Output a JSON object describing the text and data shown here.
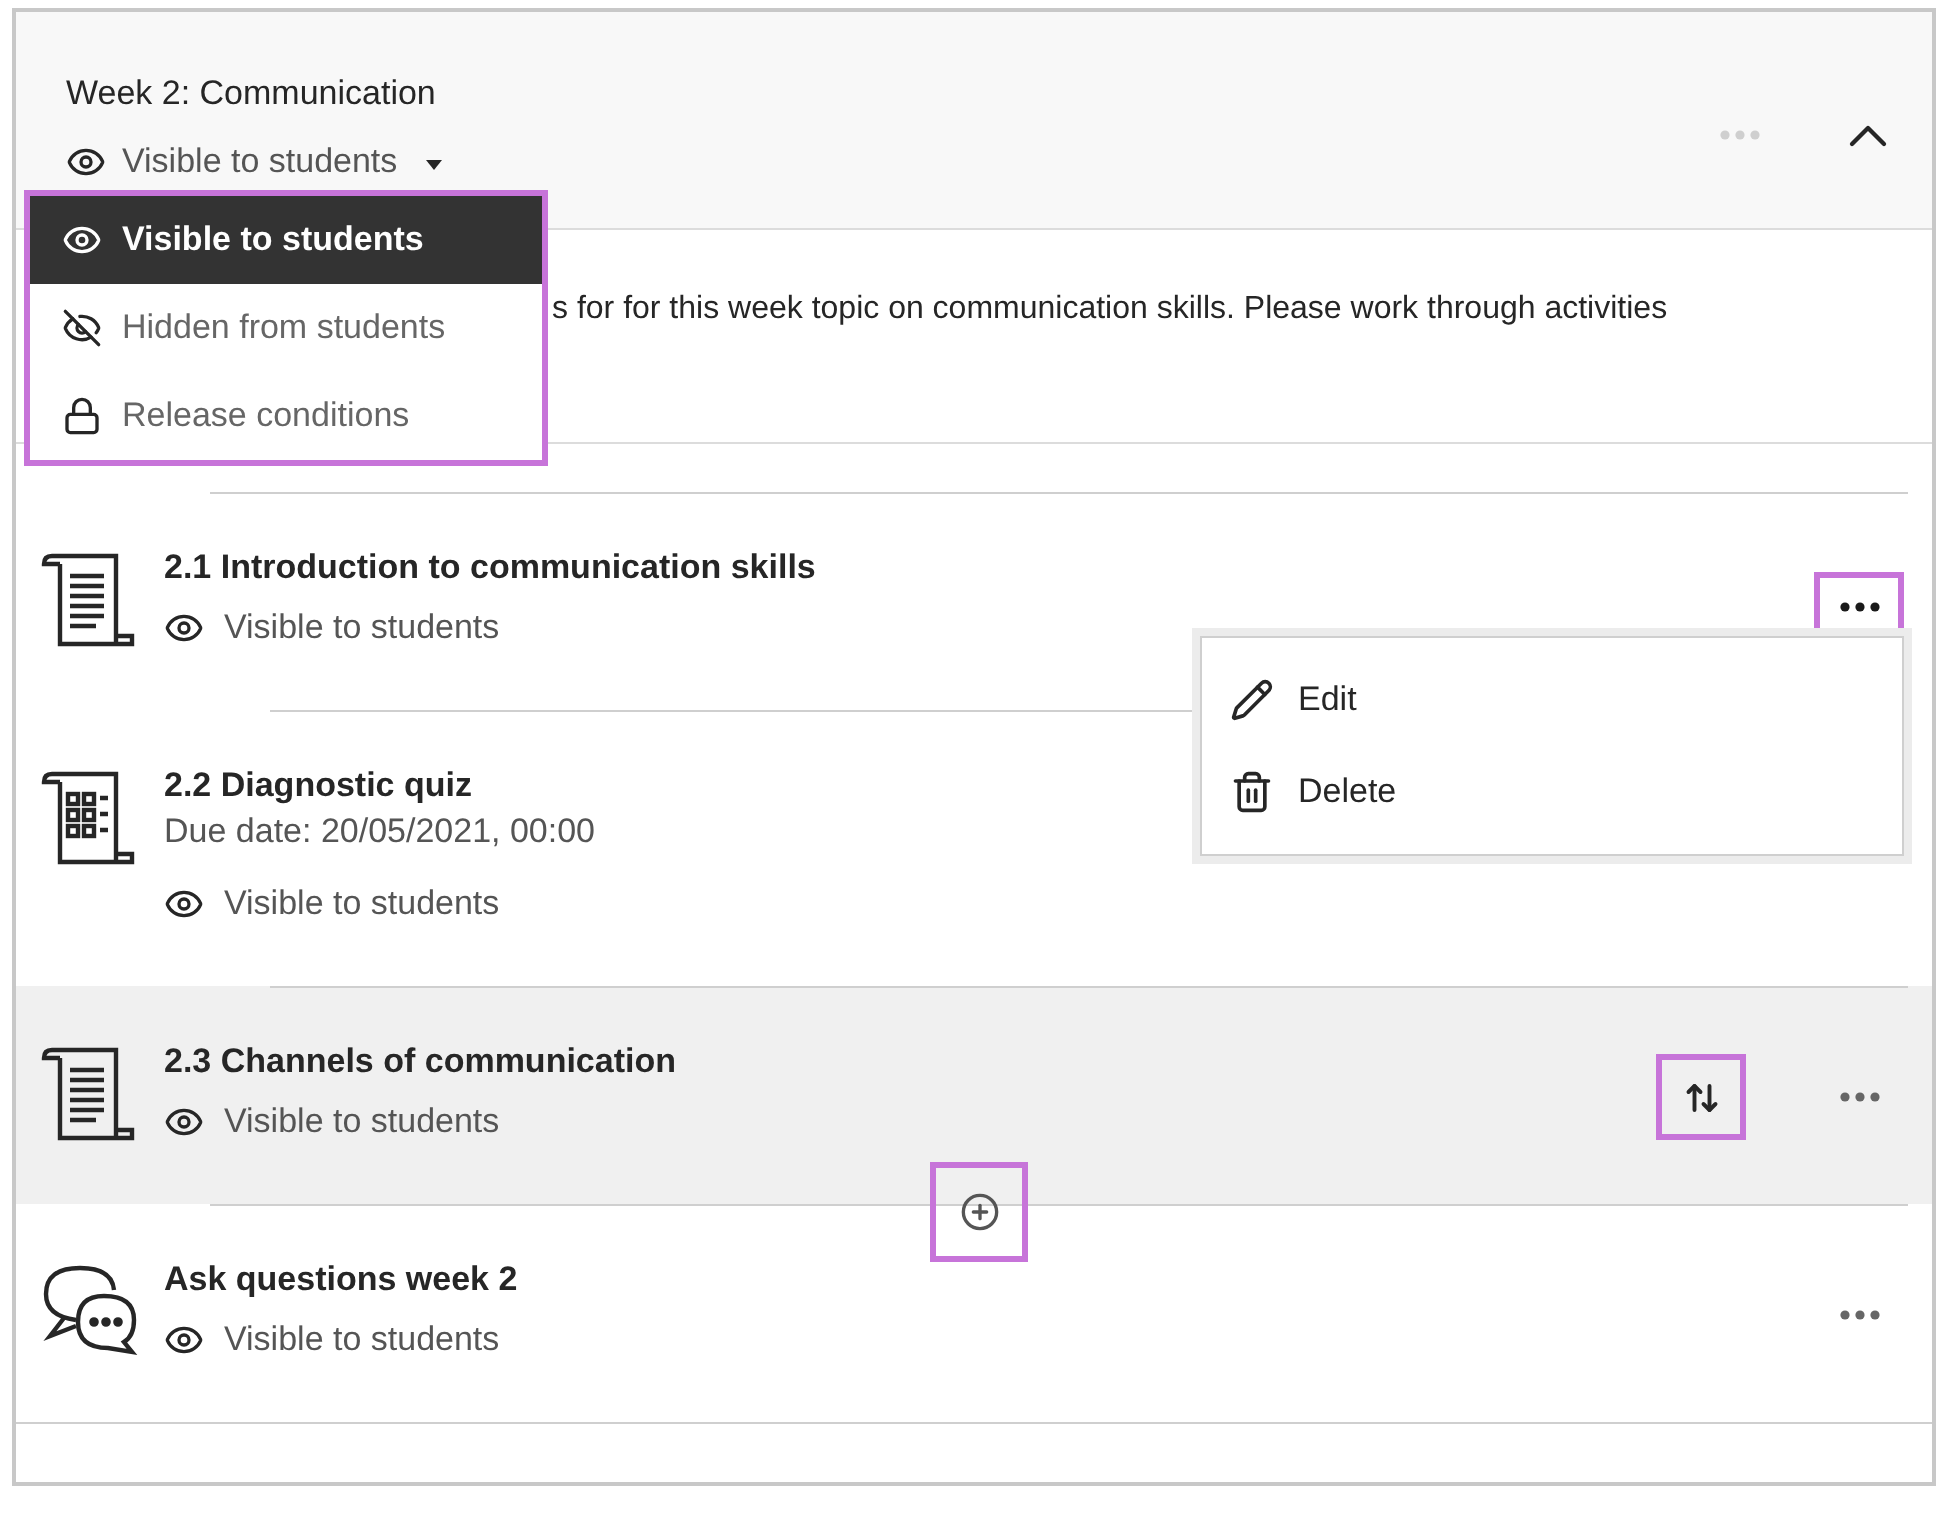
{
  "section": {
    "title": "Week 2: Communication",
    "visibility": "Visible to students",
    "expanded": true,
    "visibility_menu": [
      {
        "label": "Visible to students",
        "selected": true
      },
      {
        "label": "Hidden from students",
        "selected": false
      },
      {
        "label": "Release conditions",
        "selected": false
      }
    ],
    "description": "s for for this week topic on communication skills. Please work through activities"
  },
  "items": [
    {
      "kind": "document",
      "title": "2.1 Introduction to communication skills",
      "visibility": "Visible to students",
      "hovered": false,
      "menu_open": true
    },
    {
      "kind": "quiz",
      "title": "2.2 Diagnostic quiz",
      "due": "Due date: 20/05/2021, 00:00",
      "visibility": "Visible to students",
      "hovered": false,
      "menu_open": false
    },
    {
      "kind": "document",
      "title": "2.3 Channels of communication",
      "visibility": "Visible to students",
      "hovered": true,
      "menu_open": false
    },
    {
      "kind": "discussion",
      "title": "Ask questions week 2",
      "visibility": "Visible to students",
      "hovered": false,
      "menu_open": false
    }
  ],
  "item_menu": [
    {
      "label": "Edit"
    },
    {
      "label": "Delete"
    }
  ]
}
